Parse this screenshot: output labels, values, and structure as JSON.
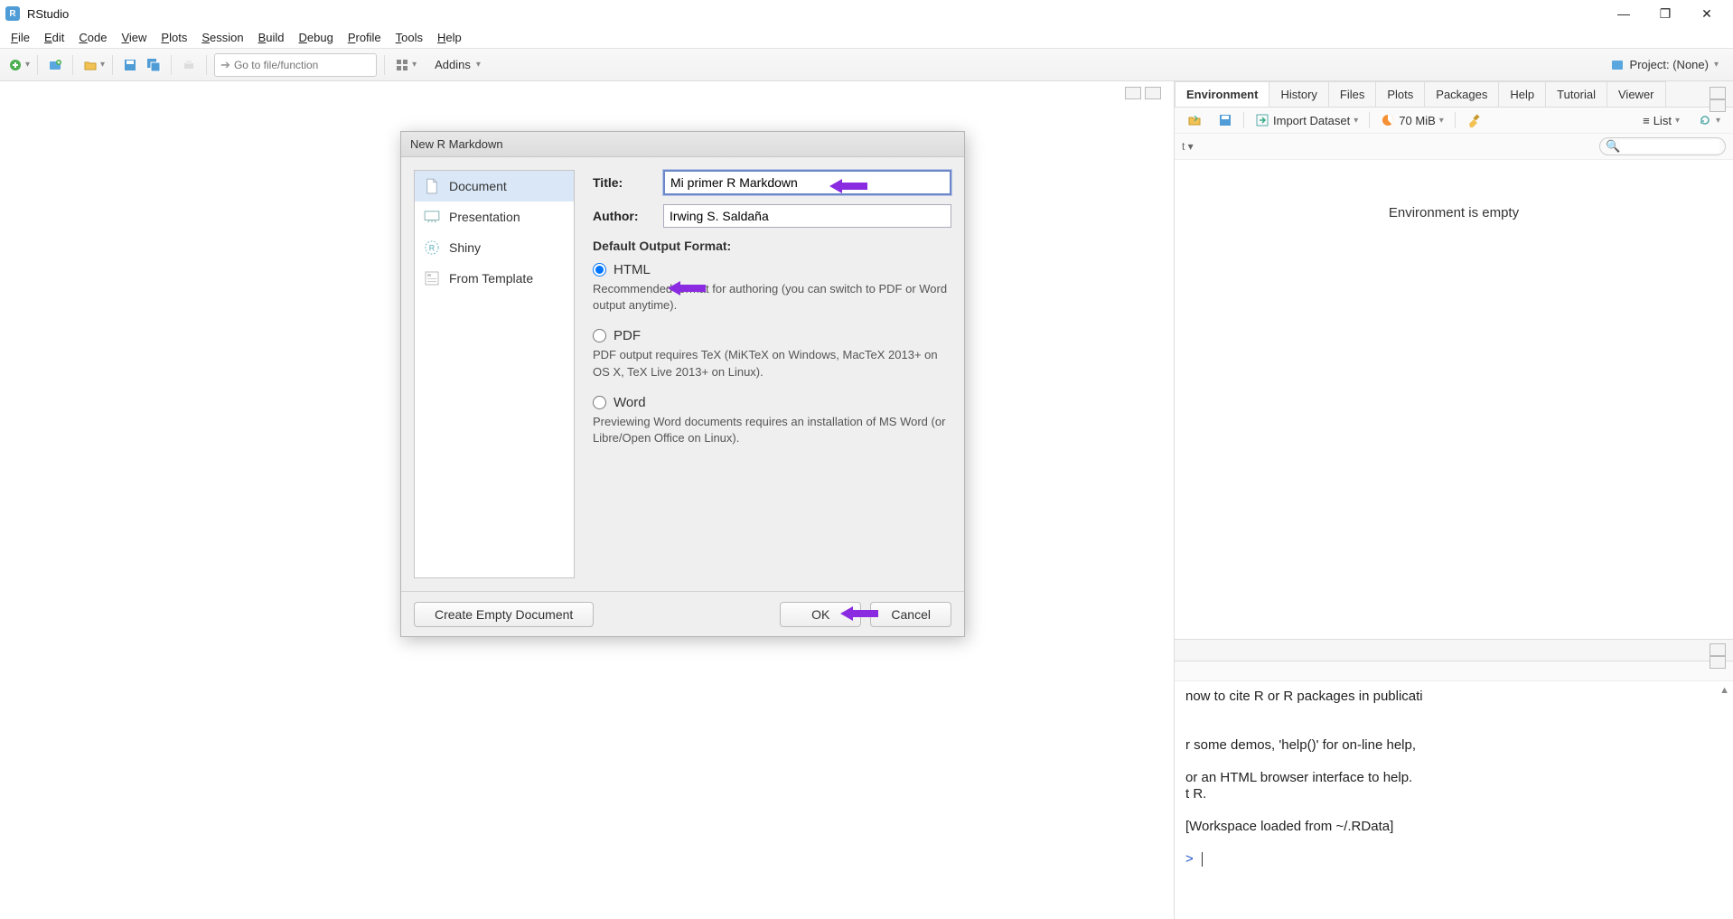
{
  "app": {
    "title": "RStudio"
  },
  "menubar": [
    "File",
    "Edit",
    "Code",
    "View",
    "Plots",
    "Session",
    "Build",
    "Debug",
    "Profile",
    "Tools",
    "Help"
  ],
  "toolbar": {
    "goto_placeholder": "Go to file/function",
    "addins_label": "Addins",
    "project_label": "Project: (None)"
  },
  "dialog": {
    "title": "New R Markdown",
    "sidebar": [
      "Document",
      "Presentation",
      "Shiny",
      "From Template"
    ],
    "title_label": "Title:",
    "title_value": "Mi primer R Markdown",
    "author_label": "Author:",
    "author_value": "Irwing S. Saldaña",
    "output_section": "Default Output Format:",
    "formats": {
      "html": {
        "label": "HTML",
        "desc": "Recommended format for authoring (you can switch to PDF or Word output anytime)."
      },
      "pdf": {
        "label": "PDF",
        "desc": "PDF output requires TeX (MiKTeX on Windows, MacTeX 2013+ on OS X, TeX Live 2013+ on Linux)."
      },
      "word": {
        "label": "Word",
        "desc": "Previewing Word documents requires an installation of MS Word (or Libre/Open Office on Linux)."
      }
    },
    "create_empty": "Create Empty Document",
    "ok": "OK",
    "cancel": "Cancel"
  },
  "env_panel": {
    "tabs": [
      "Environment",
      "History",
      "Files",
      "Plots",
      "Packages",
      "Help",
      "Tutorial",
      "Viewer"
    ],
    "import_label": "Import Dataset",
    "mem_label": "70 MiB",
    "list_label": "List",
    "empty_msg": "Environment is empty",
    "search_placeholder": ""
  },
  "console": {
    "lines": [
      "now to cite R or R packages in publicati",
      "",
      "",
      "r some demos, 'help()' for on-line help,",
      "",
      "or an HTML browser interface to help.",
      "t R.",
      "",
      "[Workspace loaded from ~/.RData]",
      ""
    ],
    "prompt": ">"
  }
}
